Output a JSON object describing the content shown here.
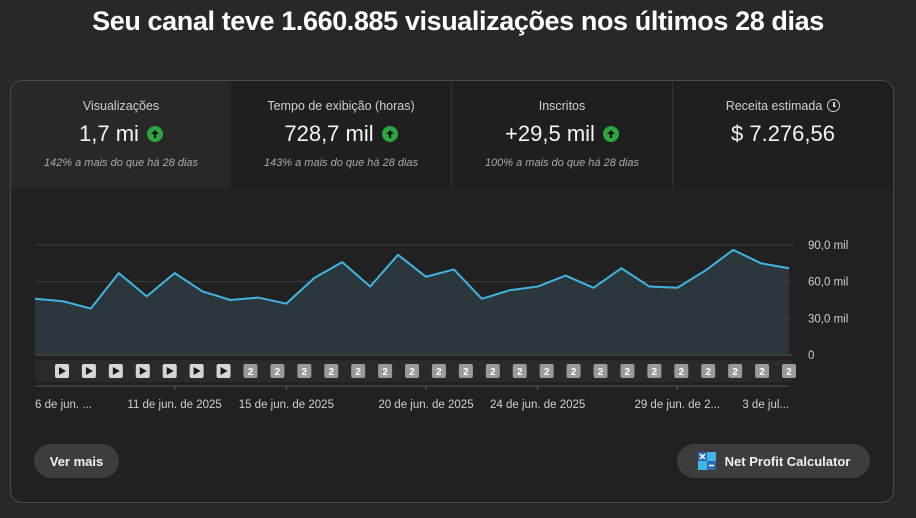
{
  "headline": "Seu canal teve 1.660.885 visualizações nos últimos 28 dias",
  "metrics": [
    {
      "label": "Visualizações",
      "value": "1,7 mi",
      "sub": "142% a mais do que há 28 dias",
      "trend": "up"
    },
    {
      "label": "Tempo de exibição (horas)",
      "value": "728,7 mil",
      "sub": "143% a mais do que há 28 dias",
      "trend": "up"
    },
    {
      "label": "Inscritos",
      "value": "+29,5 mil",
      "sub": "100% a mais do que há 28 dias",
      "trend": "up"
    },
    {
      "label": "Receita estimada",
      "value": "$ 7.276,56",
      "sub": "",
      "trend": "none",
      "icon": "clock-icon"
    }
  ],
  "chart_data": {
    "type": "area",
    "x": [
      "6 jun",
      "7 jun",
      "8 jun",
      "9 jun",
      "10 jun",
      "11 jun",
      "12 jun",
      "13 jun",
      "14 jun",
      "15 jun",
      "16 jun",
      "17 jun",
      "18 jun",
      "19 jun",
      "20 jun",
      "21 jun",
      "22 jun",
      "23 jun",
      "24 jun",
      "25 jun",
      "26 jun",
      "27 jun",
      "28 jun",
      "29 jun",
      "30 jun",
      "1 jul",
      "2 jul",
      "3 jul"
    ],
    "values": [
      46,
      44,
      38,
      67,
      48,
      67,
      52,
      45,
      47,
      42,
      63,
      76,
      56,
      82,
      64,
      70,
      46,
      53,
      56,
      65,
      55,
      71,
      56,
      55,
      69,
      86,
      75,
      71
    ],
    "ylim": [
      0,
      90
    ],
    "yticks": [
      "90,0 mil",
      "60,0 mil",
      "30,0 mil",
      "0"
    ],
    "ytick_values": [
      90,
      60,
      30,
      0
    ],
    "xtick_labels": [
      {
        "index": 0,
        "label": "6 de jun. ..."
      },
      {
        "index": 5,
        "label": "11 de jun. de 2025"
      },
      {
        "index": 9,
        "label": "15 de jun. de 2025"
      },
      {
        "index": 14,
        "label": "20 de jun. de 2025"
      },
      {
        "index": 18,
        "label": "24 de jun. de 2025"
      },
      {
        "index": 23,
        "label": "29 de jun. de 2..."
      },
      {
        "index": 27,
        "label": "3 de jul..."
      }
    ],
    "markers": [
      "play",
      "play",
      "play",
      "play",
      "play",
      "play",
      "play",
      "2",
      "2",
      "2",
      "2",
      "2",
      "2",
      "2",
      "2",
      "2",
      "2",
      "2",
      "2",
      "2",
      "2",
      "2",
      "2",
      "2",
      "2",
      "2",
      "2",
      "2"
    ],
    "line_color": "#41b4e0",
    "fill_color": "#2d3a40",
    "grid": true
  },
  "buttons": {
    "more": "Ver mais",
    "npc": "Net Profit Calculator"
  },
  "colors": {
    "up": "#2ba640"
  }
}
